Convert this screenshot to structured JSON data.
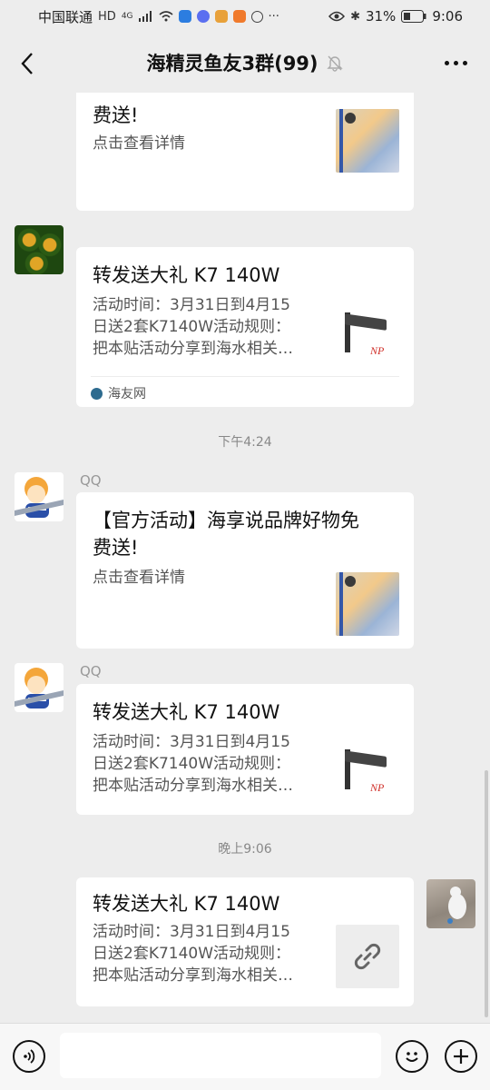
{
  "status_bar": {
    "carrier": "中国联通",
    "network": "4G",
    "battery": "31%",
    "time": "9:06"
  },
  "header": {
    "title": "海精灵鱼友3群(99)"
  },
  "messages": [
    {
      "kind": "card",
      "title_tail": "费送!",
      "desc": "点击查看详情"
    },
    {
      "kind": "card",
      "title": "转发送大礼 K7 140W",
      "desc": "活动时间：3月31日到4月15\n日送2套K7140W活动规则：\n把本贴活动分享到海水相关…",
      "source": "海友网"
    },
    {
      "kind": "timestamp",
      "text": "下午4:24"
    },
    {
      "kind": "card",
      "sender": "QQ",
      "title": "【官方活动】海享说品牌好物免\n费送!",
      "desc": "点击查看详情"
    },
    {
      "kind": "card",
      "sender": "QQ",
      "title": "转发送大礼 K7 140W",
      "desc": "活动时间：3月31日到4月15\n日送2套K7140W活动规则：\n把本贴活动分享到海水相关…"
    },
    {
      "kind": "timestamp",
      "text": "晚上9:06"
    },
    {
      "kind": "card",
      "self": true,
      "title": "转发送大礼 K7 140W",
      "desc": "活动时间：3月31日到4月15\n日送2套K7140W活动规则：\n把本贴活动分享到海水相关…"
    }
  ],
  "icons": {
    "back": "chevron-left-icon",
    "mute": "bell-off-icon",
    "more": "more-dots-icon",
    "voice": "voice-icon",
    "emoji": "emoji-icon",
    "add": "plus-icon",
    "link": "link-icon"
  },
  "colors": {
    "background": "#ededed",
    "card": "#ffffff",
    "secondary_text": "#888888"
  }
}
